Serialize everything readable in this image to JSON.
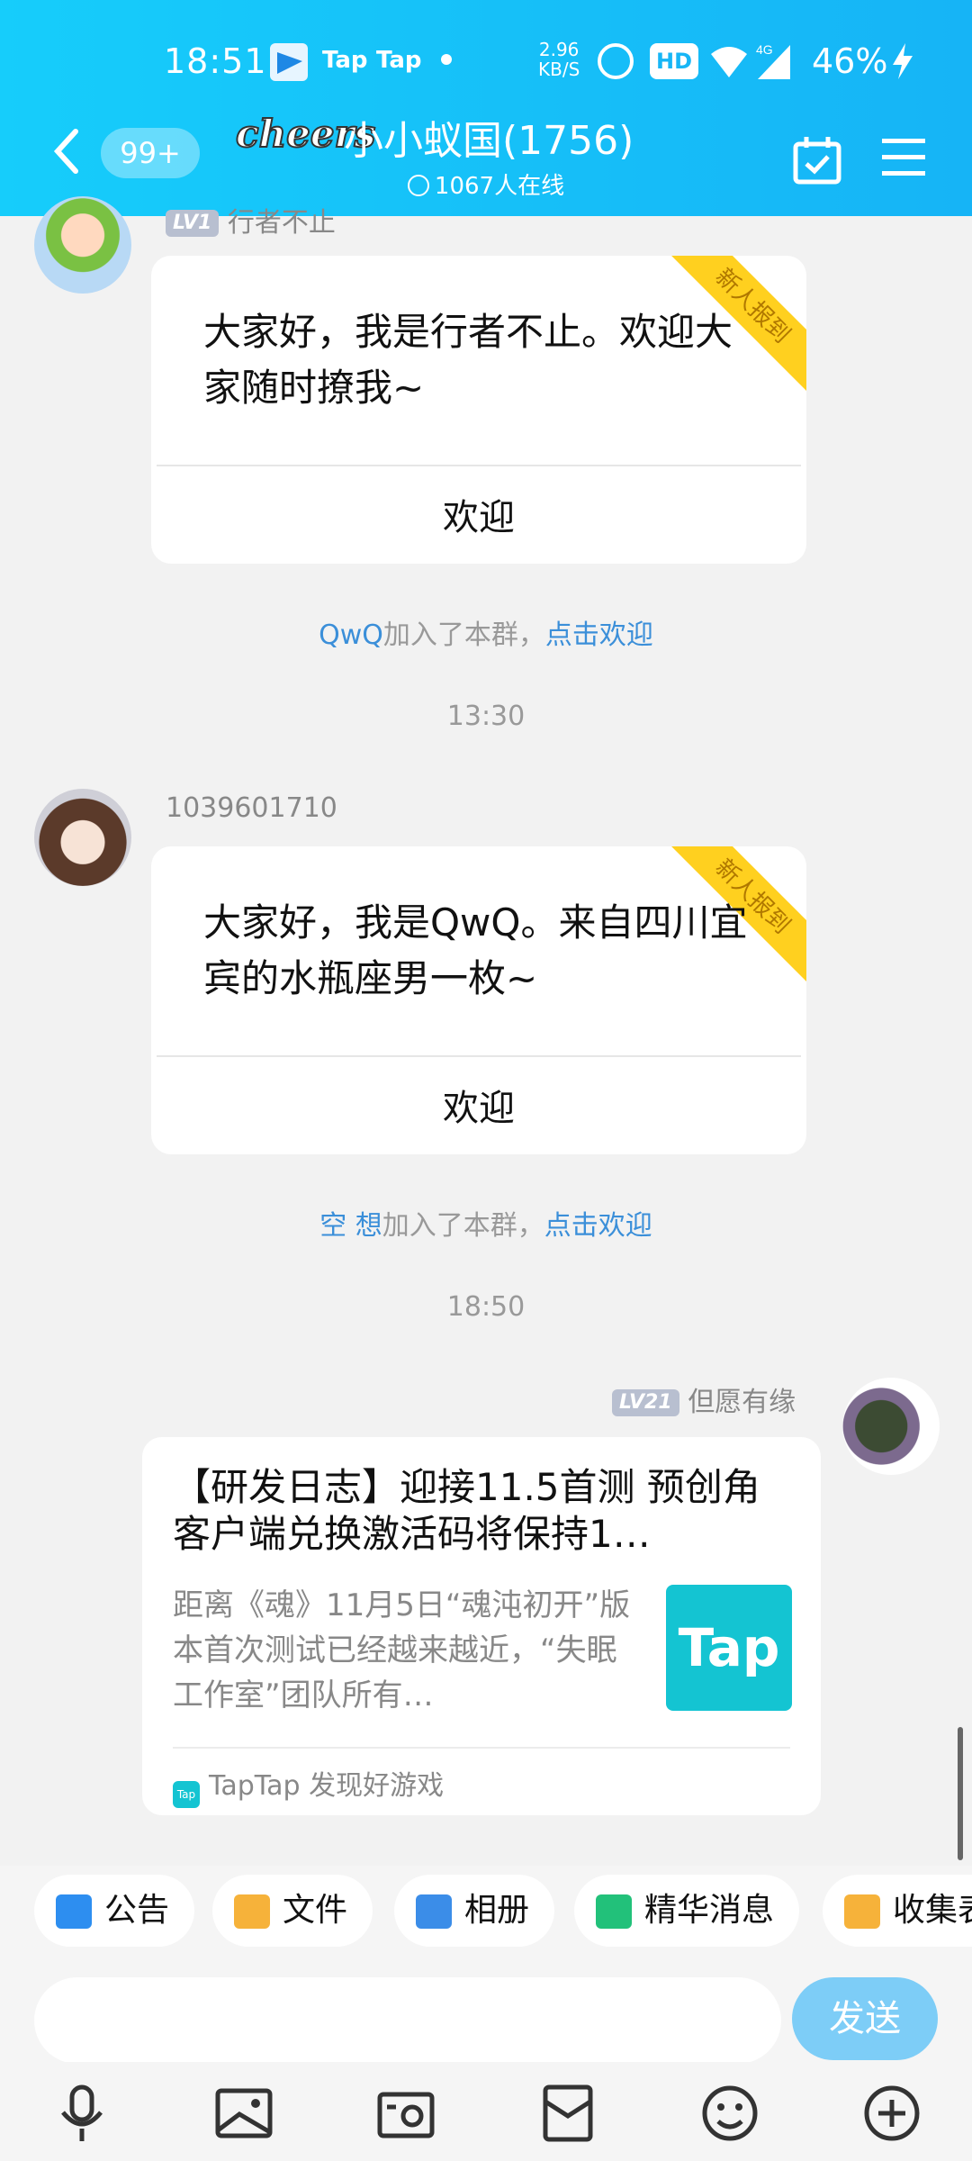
{
  "status_bar": {
    "time": "18:51",
    "app1": "Tap",
    "app2": "Tap",
    "speed_value": "2.96",
    "speed_unit": "KB/S",
    "hd": "HD",
    "network": "4G",
    "battery": "46%"
  },
  "header": {
    "unread_badge": "99+",
    "brand": "cheers",
    "title": "小小蚁国(1756)",
    "online": "1067人在线"
  },
  "messages": {
    "m1": {
      "sender_level": "LV1",
      "sender_name": "行者不止",
      "ribbon": "新人报到",
      "text": "大家好，我是行者不止。欢迎大家随时撩我~",
      "button": "欢迎"
    },
    "join1": {
      "user": "QwQ",
      "text": "加入了本群，",
      "action": "点击欢迎"
    },
    "time1": "13:30",
    "m2": {
      "sender_name": "1039601710",
      "ribbon": "新人报到",
      "text": "大家好，我是QwQ。来自四川宜宾的水瓶座男一枚~",
      "button": "欢迎"
    },
    "join2": {
      "user": "空 想",
      "text": "加入了本群，",
      "action": "点击欢迎"
    },
    "time2": "18:50",
    "m3": {
      "sender_level": "LV21",
      "sender_name": "但愿有缘",
      "share_title": "【研发日志】迎接11.5首测 预创角客户端兑换激活码将保持1…",
      "share_desc": "距离《魂》11月5日“魂沌初开”版本首次测试已经越来越近，“失眠工作室”团队所有…",
      "thumb_text": "Tap",
      "source_icon": "Tap",
      "source": "TapTap 发现好游戏"
    }
  },
  "quick_actions": [
    "公告",
    "文件",
    "相册",
    "精华消息",
    "收集表"
  ],
  "input": {
    "placeholder": "",
    "send": "发送"
  },
  "colors": {
    "header": "#16bdf8",
    "link": "#3b8fd9",
    "ribbon": "#ffd01f",
    "send": "#7dcdf7"
  }
}
